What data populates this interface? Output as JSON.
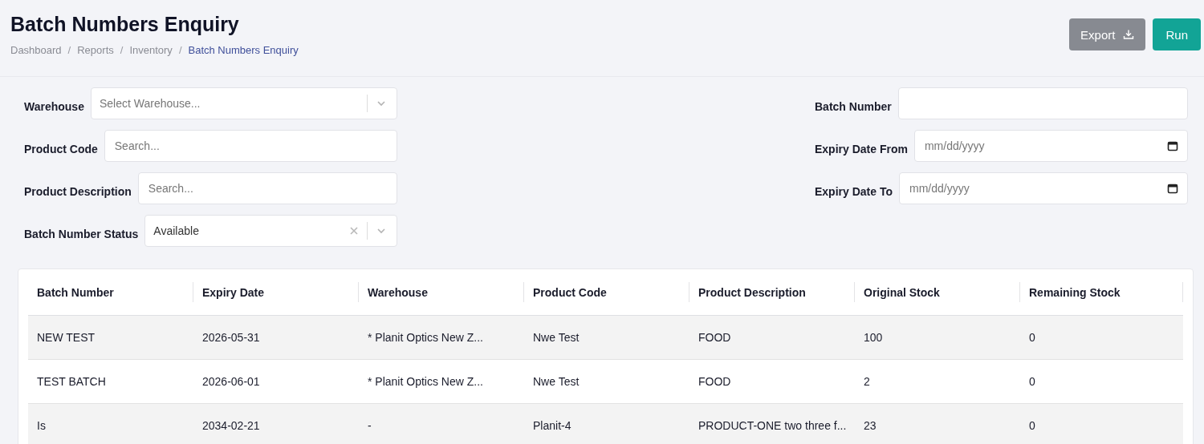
{
  "page": {
    "title": "Batch Numbers Enquiry",
    "breadcrumb_separator": "/",
    "breadcrumb": [
      {
        "label": "Dashboard",
        "current": false
      },
      {
        "label": "Reports",
        "current": false
      },
      {
        "label": "Inventory",
        "current": false
      },
      {
        "label": "Batch Numbers Enquiry",
        "current": true
      }
    ],
    "actions": [
      {
        "label": "Export",
        "kind": "secondary"
      },
      {
        "label": "Run",
        "kind": "primary"
      }
    ]
  },
  "filters": {
    "left": [
      {
        "label": "Warehouse",
        "kind": "select",
        "placeholder": "Select Warehouse..."
      },
      {
        "label": "Product Code",
        "kind": "text",
        "placeholder": "Search..."
      },
      {
        "label": "Product Description",
        "kind": "text",
        "placeholder": "Search..."
      },
      {
        "label": "Batch Number Status",
        "kind": "select",
        "value": "Available"
      }
    ],
    "right": [
      {
        "label": "Batch Number",
        "kind": "text"
      },
      {
        "label": "Expiry Date From",
        "kind": "date",
        "placeholder": "mm/dd/yyyy"
      },
      {
        "label": "Expiry Date To",
        "kind": "date",
        "placeholder": "mm/dd/yyyy"
      }
    ]
  },
  "table": {
    "columns": [
      "Batch Number",
      "Expiry Date",
      "Warehouse",
      "Product Code",
      "Product Description",
      "Original Stock",
      "Remaining Stock"
    ],
    "rows": [
      [
        "NEW TEST",
        "2026-05-31",
        "* Planit Optics New Z...",
        "Nwe Test",
        "FOOD",
        "100",
        "0"
      ],
      [
        "TEST BATCH",
        "2026-06-01",
        "* Planit Optics New Z...",
        "Nwe Test",
        "FOOD",
        "2",
        "0"
      ],
      [
        "Is",
        "2034-02-21",
        "-",
        "Planit-4",
        "PRODUCT-ONE two three f...",
        "23",
        "0"
      ]
    ]
  }
}
